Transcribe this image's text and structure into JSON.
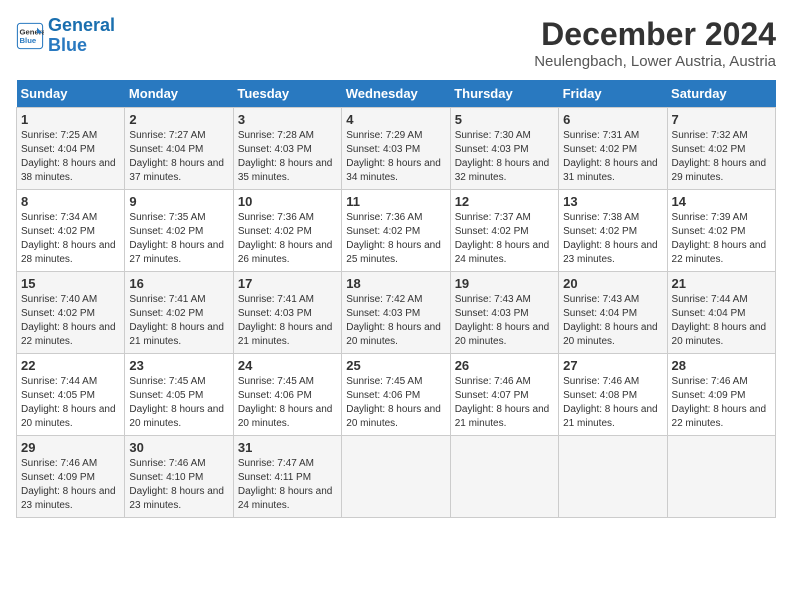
{
  "logo": {
    "line1": "General",
    "line2": "Blue"
  },
  "title": "December 2024",
  "subtitle": "Neulengbach, Lower Austria, Austria",
  "days_of_week": [
    "Sunday",
    "Monday",
    "Tuesday",
    "Wednesday",
    "Thursday",
    "Friday",
    "Saturday"
  ],
  "weeks": [
    [
      {
        "day": "1",
        "sunrise": "7:25 AM",
        "sunset": "4:04 PM",
        "daylight": "8 hours and 38 minutes."
      },
      {
        "day": "2",
        "sunrise": "7:27 AM",
        "sunset": "4:04 PM",
        "daylight": "8 hours and 37 minutes."
      },
      {
        "day": "3",
        "sunrise": "7:28 AM",
        "sunset": "4:03 PM",
        "daylight": "8 hours and 35 minutes."
      },
      {
        "day": "4",
        "sunrise": "7:29 AM",
        "sunset": "4:03 PM",
        "daylight": "8 hours and 34 minutes."
      },
      {
        "day": "5",
        "sunrise": "7:30 AM",
        "sunset": "4:03 PM",
        "daylight": "8 hours and 32 minutes."
      },
      {
        "day": "6",
        "sunrise": "7:31 AM",
        "sunset": "4:02 PM",
        "daylight": "8 hours and 31 minutes."
      },
      {
        "day": "7",
        "sunrise": "7:32 AM",
        "sunset": "4:02 PM",
        "daylight": "8 hours and 29 minutes."
      }
    ],
    [
      {
        "day": "8",
        "sunrise": "7:34 AM",
        "sunset": "4:02 PM",
        "daylight": "8 hours and 28 minutes."
      },
      {
        "day": "9",
        "sunrise": "7:35 AM",
        "sunset": "4:02 PM",
        "daylight": "8 hours and 27 minutes."
      },
      {
        "day": "10",
        "sunrise": "7:36 AM",
        "sunset": "4:02 PM",
        "daylight": "8 hours and 26 minutes."
      },
      {
        "day": "11",
        "sunrise": "7:36 AM",
        "sunset": "4:02 PM",
        "daylight": "8 hours and 25 minutes."
      },
      {
        "day": "12",
        "sunrise": "7:37 AM",
        "sunset": "4:02 PM",
        "daylight": "8 hours and 24 minutes."
      },
      {
        "day": "13",
        "sunrise": "7:38 AM",
        "sunset": "4:02 PM",
        "daylight": "8 hours and 23 minutes."
      },
      {
        "day": "14",
        "sunrise": "7:39 AM",
        "sunset": "4:02 PM",
        "daylight": "8 hours and 22 minutes."
      }
    ],
    [
      {
        "day": "15",
        "sunrise": "7:40 AM",
        "sunset": "4:02 PM",
        "daylight": "8 hours and 22 minutes."
      },
      {
        "day": "16",
        "sunrise": "7:41 AM",
        "sunset": "4:02 PM",
        "daylight": "8 hours and 21 minutes."
      },
      {
        "day": "17",
        "sunrise": "7:41 AM",
        "sunset": "4:03 PM",
        "daylight": "8 hours and 21 minutes."
      },
      {
        "day": "18",
        "sunrise": "7:42 AM",
        "sunset": "4:03 PM",
        "daylight": "8 hours and 20 minutes."
      },
      {
        "day": "19",
        "sunrise": "7:43 AM",
        "sunset": "4:03 PM",
        "daylight": "8 hours and 20 minutes."
      },
      {
        "day": "20",
        "sunrise": "7:43 AM",
        "sunset": "4:04 PM",
        "daylight": "8 hours and 20 minutes."
      },
      {
        "day": "21",
        "sunrise": "7:44 AM",
        "sunset": "4:04 PM",
        "daylight": "8 hours and 20 minutes."
      }
    ],
    [
      {
        "day": "22",
        "sunrise": "7:44 AM",
        "sunset": "4:05 PM",
        "daylight": "8 hours and 20 minutes."
      },
      {
        "day": "23",
        "sunrise": "7:45 AM",
        "sunset": "4:05 PM",
        "daylight": "8 hours and 20 minutes."
      },
      {
        "day": "24",
        "sunrise": "7:45 AM",
        "sunset": "4:06 PM",
        "daylight": "8 hours and 20 minutes."
      },
      {
        "day": "25",
        "sunrise": "7:45 AM",
        "sunset": "4:06 PM",
        "daylight": "8 hours and 20 minutes."
      },
      {
        "day": "26",
        "sunrise": "7:46 AM",
        "sunset": "4:07 PM",
        "daylight": "8 hours and 21 minutes."
      },
      {
        "day": "27",
        "sunrise": "7:46 AM",
        "sunset": "4:08 PM",
        "daylight": "8 hours and 21 minutes."
      },
      {
        "day": "28",
        "sunrise": "7:46 AM",
        "sunset": "4:09 PM",
        "daylight": "8 hours and 22 minutes."
      }
    ],
    [
      {
        "day": "29",
        "sunrise": "7:46 AM",
        "sunset": "4:09 PM",
        "daylight": "8 hours and 23 minutes."
      },
      {
        "day": "30",
        "sunrise": "7:46 AM",
        "sunset": "4:10 PM",
        "daylight": "8 hours and 23 minutes."
      },
      {
        "day": "31",
        "sunrise": "7:47 AM",
        "sunset": "4:11 PM",
        "daylight": "8 hours and 24 minutes."
      },
      null,
      null,
      null,
      null
    ]
  ]
}
